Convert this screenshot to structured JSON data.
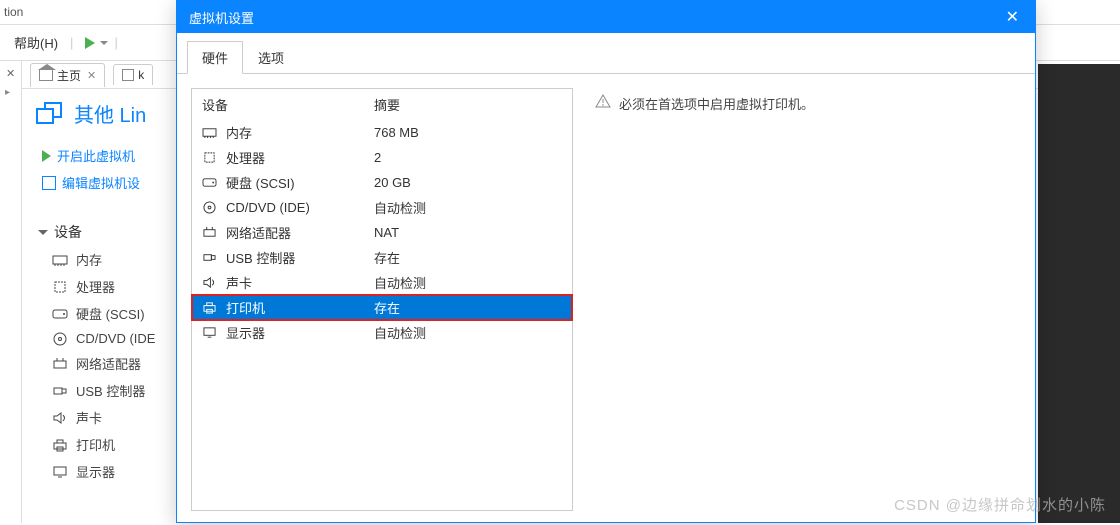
{
  "bg": {
    "title_fragment": "tion",
    "help_menu": "帮助(H)",
    "home_tab": "主页",
    "second_tab_prefix": "k",
    "vm_title": "其他 Lin",
    "action_start": "开启此虚拟机",
    "action_edit": "编辑虚拟机设",
    "devices_header": "设备",
    "side_devices": [
      {
        "icon": "mem",
        "label": "内存"
      },
      {
        "icon": "cpu",
        "label": "处理器"
      },
      {
        "icon": "hdd",
        "label": "硬盘 (SCSI)"
      },
      {
        "icon": "cd",
        "label": "CD/DVD (IDE"
      },
      {
        "icon": "net",
        "label": "网络适配器"
      },
      {
        "icon": "usb",
        "label": "USB 控制器"
      },
      {
        "icon": "snd",
        "label": "声卡"
      },
      {
        "icon": "prn",
        "label": "打印机"
      },
      {
        "icon": "disp",
        "label": "显示器"
      }
    ]
  },
  "modal": {
    "title": "虚拟机设置",
    "tab_hardware": "硬件",
    "tab_options": "选项",
    "col_device": "设备",
    "col_summary": "摘要",
    "rows": [
      {
        "icon": "mem",
        "name": "内存",
        "summary": "768 MB",
        "selected": false
      },
      {
        "icon": "cpu",
        "name": "处理器",
        "summary": "2",
        "selected": false
      },
      {
        "icon": "hdd",
        "name": "硬盘 (SCSI)",
        "summary": "20 GB",
        "selected": false
      },
      {
        "icon": "cd",
        "name": "CD/DVD (IDE)",
        "summary": "自动检测",
        "selected": false
      },
      {
        "icon": "net",
        "name": "网络适配器",
        "summary": "NAT",
        "selected": false
      },
      {
        "icon": "usb",
        "name": "USB 控制器",
        "summary": "存在",
        "selected": false
      },
      {
        "icon": "snd",
        "name": "声卡",
        "summary": "自动检测",
        "selected": false
      },
      {
        "icon": "prn",
        "name": "打印机",
        "summary": "存在",
        "selected": true
      },
      {
        "icon": "disp",
        "name": "显示器",
        "summary": "自动检测",
        "selected": false
      }
    ],
    "warning": "必须在首选项中启用虚拟打印机。"
  },
  "watermark": "CSDN @边缘拼命划水的小陈"
}
